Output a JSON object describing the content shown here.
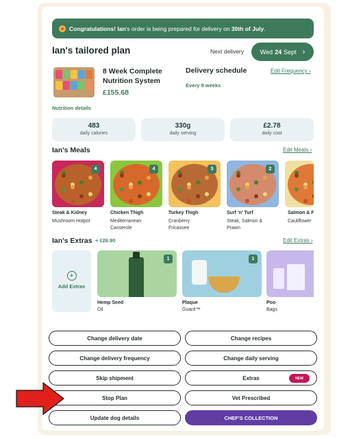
{
  "banner": {
    "congrats": "Congratulations!",
    "name": "Ian",
    "message": "'s order is being prepared for delivery on",
    "date": "30th of July",
    "end": "."
  },
  "plan": {
    "title": "Ian's tailored plan",
    "next_delivery_label": "Next delivery",
    "next_delivery_day": "Wed",
    "next_delivery_num": "24",
    "next_delivery_month": "Sept",
    "product_name": "8 Week Complete Nutrition System",
    "product_price": "£155.68",
    "schedule_title": "Delivery schedule",
    "schedule_freq": "Every 8 weeks",
    "edit_frequency": "Edit Frequency ›",
    "nutrition_label": "Nutrition details"
  },
  "stats": [
    {
      "value": "483",
      "label": "daily calories"
    },
    {
      "value": "330g",
      "label": "daily serving"
    },
    {
      "value": "£2.78",
      "label": "daily cost"
    }
  ],
  "meals": {
    "title": "Ian's Meals",
    "edit": "Edit Meals ›",
    "items": [
      {
        "name": "Steak & Kidney",
        "sub": "Mushroom Hotpot",
        "count": "4",
        "bg": "#c8285a",
        "food": "#b9612b"
      },
      {
        "name": "Chicken Thigh",
        "sub": "Mediterranean Casserole",
        "count": "4",
        "bg": "#8cc63f",
        "food": "#d6692a"
      },
      {
        "name": "Turkey Thigh",
        "sub": "Cranberry Fricassee",
        "count": "3",
        "bg": "#f4c15c",
        "food": "#b86a34"
      },
      {
        "name": "Surf 'n' Turf",
        "sub": "Steak, Salmon & Prawn",
        "count": "2",
        "bg": "#8fb7e0",
        "food": "#d48a6c"
      },
      {
        "name": "Salmon & F",
        "sub": "Cauliflower",
        "count": "",
        "bg": "#f0e0a0",
        "food": "#e07838"
      }
    ]
  },
  "extras": {
    "title": "Ian's Extras",
    "total": "+ £26.90",
    "edit": "Edit Extras ›",
    "add_label": "Add Extras",
    "items": [
      {
        "name": "Hemp Seed",
        "sub": "Oil",
        "count": "1",
        "bg": "#a8d5a0"
      },
      {
        "name": "Plaque",
        "sub": "Guard™",
        "count": "1",
        "bg": "#9fd0e0"
      },
      {
        "name": "Poo",
        "sub": "Bags",
        "count": "",
        "bg": "#c7b8ec"
      }
    ]
  },
  "buttons": {
    "change_delivery_date": "Change delivery date",
    "change_recipes": "Change recipes",
    "change_delivery_frequency": "Change delivery frequency",
    "change_daily_serving": "Change daily serving",
    "skip_shipment": "Skip shipment",
    "extras": "Extras",
    "new_badge": "NEW",
    "stop_plan": "Stop Plan",
    "vet_prescribed": "Vet Prescribed",
    "update_dog_details": "Update dog details",
    "chefs_collection": "CHEF'S COLLECTION"
  },
  "colors": {
    "primary_green": "#3d7a5c",
    "purple": "#5f3da5",
    "badge_pink": "#c2185b",
    "arrow_red": "#e0201b"
  }
}
